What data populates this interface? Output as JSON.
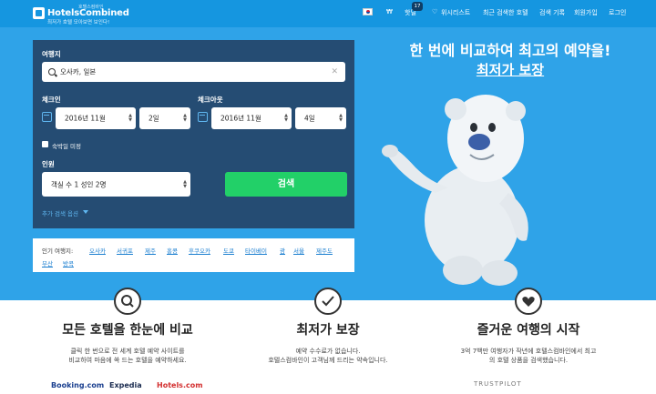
{
  "header": {
    "logo_tiny": "호텔스컴바인",
    "brand": "HotelsCombined",
    "slogan": "최저가 호텔 모아보면 보인다!",
    "currency": "₩",
    "hot_deals": "핫딜",
    "hot_deals_count": "17",
    "wishlist": "위시리스트",
    "recent_hotels": "최근 검색한 호텔",
    "search_history": "검색 기록",
    "signup": "회원가입",
    "login": "로그인"
  },
  "search": {
    "destination_label": "여행지",
    "destination_value": "오사카, 일본",
    "checkin_label": "체크인",
    "checkin_month": "2016년 11월",
    "checkin_day": "2일",
    "checkout_label": "체크아웃",
    "checkout_month": "2016년 11월",
    "checkout_day": "4일",
    "undecided_label": "숙박일 미정",
    "guests_label": "인원",
    "guests_value": "객실 수 1 성인 2명",
    "search_button": "검색",
    "more_options": "추가 검색 옵션"
  },
  "popular": {
    "label": "인기 여행지:",
    "destinations": [
      "오사카",
      "서귀포",
      "제주",
      "홍콩",
      "후쿠오카",
      "도쿄",
      "타이베이",
      "괌",
      "서울",
      "제주도",
      "부산",
      "방콕"
    ]
  },
  "hero": {
    "title": "한 번에 비교하여 최고의 예약을!",
    "subtitle": "최저가 보장"
  },
  "features": [
    {
      "icon": "magnifier-icon",
      "title": "모든 호텔을 한눈에 비교",
      "desc_line1": "클릭 한 번으로 전 세계 호텔 예약 사이트를",
      "desc_line2": "비교하여 마음에 쏙 드는 호텔을 예약하세요."
    },
    {
      "icon": "checkmark-icon",
      "title": "최저가 보장",
      "desc_line1": "예약 수수료가 없습니다.",
      "desc_line2": "호텔스컴바인이 고객님께 드리는 약속입니다."
    },
    {
      "icon": "heart-icon",
      "title": "즐거운 여행의 시작",
      "desc_line1": "3억 7백만 여행자가 작년에 호텔스컴바인에서 최고",
      "desc_line2": "의 호텔 상품을 검색했습니다."
    }
  ],
  "partners": [
    "Booking.com",
    "Expedia",
    "Hotels.com"
  ],
  "awards": [
    "TRUSTPILOT"
  ],
  "colors": {
    "nav_bg": "#1596e0",
    "hero_bg": "#2fa3e8",
    "panel_bg": "#254c73",
    "search_button": "#22d068",
    "link": "#1c7fd0"
  }
}
